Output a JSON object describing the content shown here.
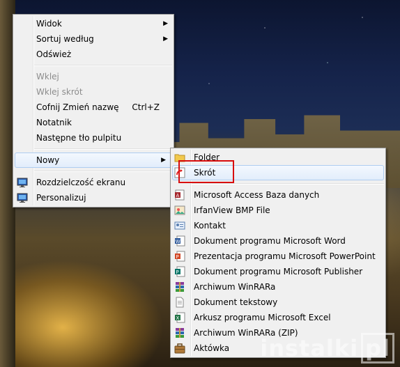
{
  "desktop_menu": {
    "items": [
      {
        "label": "Widok",
        "submenu": true
      },
      {
        "label": "Sortuj według",
        "submenu": true
      },
      {
        "label": "Odśwież"
      },
      {
        "separator": true
      },
      {
        "label": "Wklej",
        "disabled": true
      },
      {
        "label": "Wklej skrót",
        "disabled": true
      },
      {
        "label": "Cofnij Zmień nazwę",
        "shortcut": "Ctrl+Z"
      },
      {
        "label": "Notatnik"
      },
      {
        "label": "Następne tło pulpitu"
      },
      {
        "separator": true
      },
      {
        "label": "Nowy",
        "submenu": true,
        "highlighted": true
      },
      {
        "separator": true
      },
      {
        "label": "Rozdzielczość ekranu",
        "icon": "monitor-icon"
      },
      {
        "label": "Personalizuj",
        "icon": "monitor-icon"
      }
    ]
  },
  "new_submenu": {
    "items": [
      {
        "label": "Folder",
        "icon": "folder-icon"
      },
      {
        "label": "Skrót",
        "icon": "shortcut-icon",
        "highlighted": true
      },
      {
        "separator": true
      },
      {
        "label": "Microsoft Access Baza danych",
        "icon": "access-icon"
      },
      {
        "label": "IrfanView BMP File",
        "icon": "bmp-icon"
      },
      {
        "label": "Kontakt",
        "icon": "contact-icon"
      },
      {
        "label": "Dokument programu Microsoft Word",
        "icon": "word-icon"
      },
      {
        "label": "Prezentacja programu Microsoft PowerPoint",
        "icon": "powerpoint-icon"
      },
      {
        "label": "Dokument programu Microsoft Publisher",
        "icon": "publisher-icon"
      },
      {
        "label": "Archiwum WinRARa",
        "icon": "winrar-icon"
      },
      {
        "label": "Dokument tekstowy",
        "icon": "text-document-icon"
      },
      {
        "label": "Arkusz programu Microsoft Excel",
        "icon": "excel-icon"
      },
      {
        "label": "Archiwum WinRARa (ZIP)",
        "icon": "winrar-zip-icon"
      },
      {
        "label": "Aktówka",
        "icon": "briefcase-icon"
      }
    ]
  },
  "watermark": {
    "text": "instalki",
    "suffix": "pl"
  }
}
